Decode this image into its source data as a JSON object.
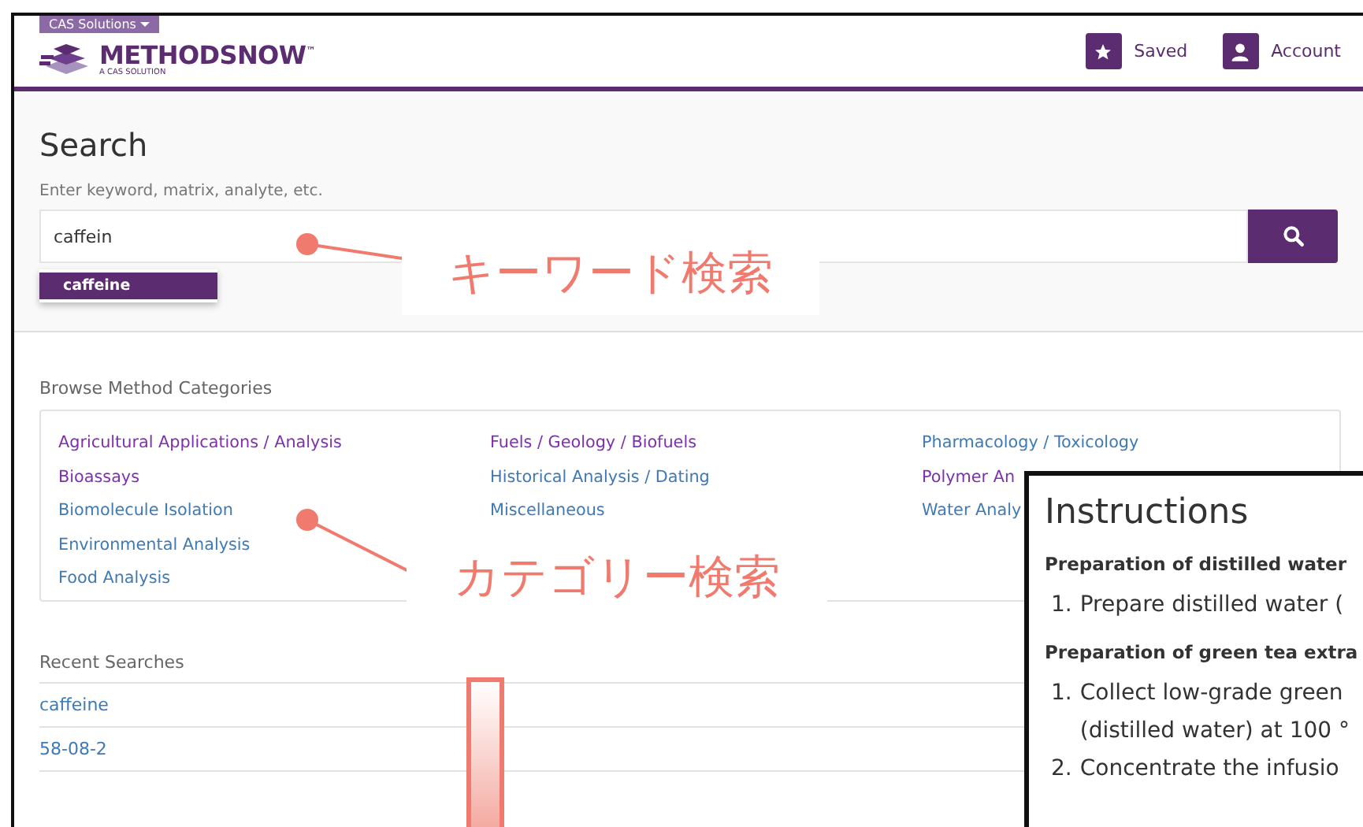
{
  "header": {
    "solutions_menu": "CAS Solutions",
    "logo": {
      "name": "METHODSNOW",
      "trademark": "™",
      "tagline": "A CAS SOLUTION"
    },
    "nav": [
      {
        "label": "Saved"
      },
      {
        "label": "Account"
      }
    ]
  },
  "search": {
    "title": "Search",
    "label": "Enter keyword, matrix, analyte, etc.",
    "value": "caffein",
    "suggestions": [
      {
        "label": "caffeine",
        "selected": true
      }
    ]
  },
  "categories": {
    "title": "Browse Method Categories",
    "columns": [
      [
        {
          "label": "Agricultural Applications / Analysis",
          "visited": true
        },
        {
          "label": "Bioassays",
          "visited": true
        },
        {
          "label": "Biomolecule Isolation",
          "visited": false
        },
        {
          "label": "Environmental Analysis",
          "visited": false
        },
        {
          "label": "Food Analysis",
          "visited": false
        }
      ],
      [
        {
          "label": "Fuels / Geology / Biofuels",
          "visited": true
        },
        {
          "label": "Historical Analysis / Dating",
          "visited": false
        },
        {
          "label": "Miscellaneous",
          "visited": false
        }
      ],
      [
        {
          "label": "Pharmacology / Toxicology",
          "visited": false
        },
        {
          "label": "Polymer An",
          "visited": true
        },
        {
          "label": "Water Analy",
          "visited": false
        }
      ]
    ]
  },
  "recent": {
    "title": "Recent Searches",
    "items": [
      "caffeine",
      "58-08-2"
    ]
  },
  "instructions": {
    "title": "Instructions",
    "sections": [
      {
        "heading": "Preparation of distilled water",
        "steps": [
          {
            "number": "1.",
            "lines": [
              "Prepare distilled water ("
            ]
          }
        ]
      },
      {
        "heading": "Preparation of green tea extra",
        "steps": [
          {
            "number": "1.",
            "lines": [
              "Collect low-grade green",
              "(distilled water) at 100 °"
            ]
          },
          {
            "number": "2.",
            "lines": [
              "Concentrate the infusio"
            ]
          }
        ]
      }
    ]
  },
  "annotations": [
    {
      "kind": "callout",
      "text": "キーワード検索"
    },
    {
      "kind": "callout",
      "text": "カテゴリー検索"
    },
    {
      "kind": "arrow"
    }
  ]
}
